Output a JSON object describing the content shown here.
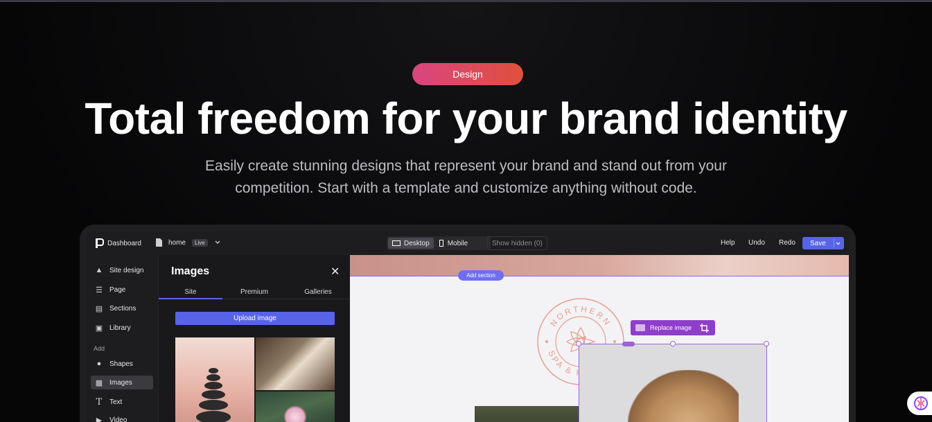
{
  "hero": {
    "badge": "Design",
    "title": "Total freedom for your brand identity",
    "subtitle_line1": "Easily create stunning designs that represent your brand and stand out from your",
    "subtitle_line2": "competition. Start with a template and customize anything without code."
  },
  "editor": {
    "topbar": {
      "dashboard": "Dashboard",
      "page_name": "home",
      "page_status": "Live",
      "desktop": "Desktop",
      "mobile": "Mobile",
      "show_hidden": "Show hidden (0)",
      "help": "Help",
      "undo": "Undo",
      "redo": "Redo",
      "save": "Save"
    },
    "sidebar": {
      "items": [
        {
          "label": "Site design",
          "icon": "brush-icon"
        },
        {
          "label": "Page",
          "icon": "sliders-icon"
        },
        {
          "label": "Sections",
          "icon": "sections-icon"
        },
        {
          "label": "Library",
          "icon": "bookmark-icon"
        }
      ],
      "add_label": "Add",
      "add_items": [
        {
          "label": "Shapes",
          "icon": "shapes-icon"
        },
        {
          "label": "Images",
          "icon": "image-icon"
        },
        {
          "label": "Text",
          "icon": "text-icon"
        },
        {
          "label": "Video",
          "icon": "video-icon"
        }
      ]
    },
    "panel": {
      "title": "Images",
      "tabs": [
        "Site",
        "Premium",
        "Galleries"
      ],
      "upload_label": "Upload image"
    },
    "canvas": {
      "add_section": "Add section",
      "replace_image": "Replace image",
      "logo_text_top": "NORTHERN",
      "logo_text_bottom": "SPA & RESORT",
      "accent_color": "#5764e8",
      "selection_color": "#9d63d6"
    }
  }
}
